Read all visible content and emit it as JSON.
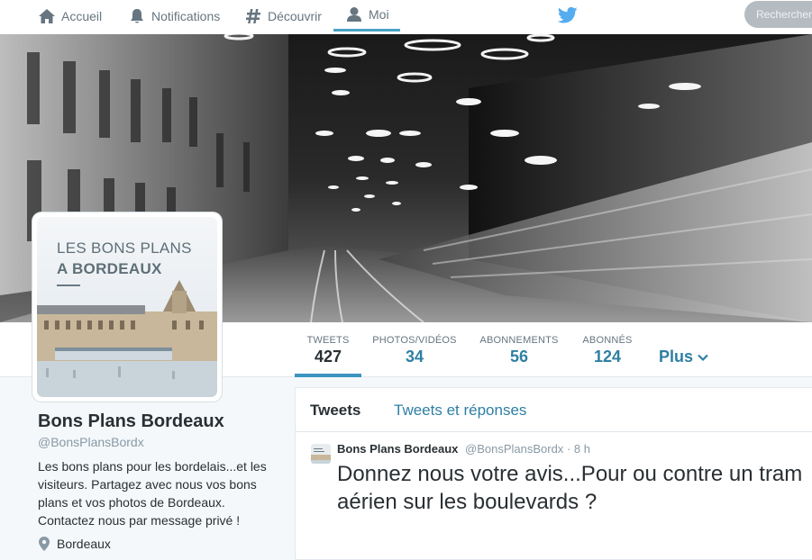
{
  "nav": {
    "home": "Accueil",
    "notifications": "Notifications",
    "discover": "Découvrir",
    "me": "Moi",
    "search_placeholder": "Rechercher"
  },
  "avatar": {
    "line1": "LES BONS PLANS",
    "line2": "A BORDEAUX"
  },
  "stats": {
    "tweets": {
      "label": "TWEETS",
      "value": "427"
    },
    "photos": {
      "label": "PHOTOS/VIDÉOS",
      "value": "34"
    },
    "following": {
      "label": "ABONNEMENTS",
      "value": "56"
    },
    "followers": {
      "label": "ABONNÉS",
      "value": "124"
    },
    "more": "Plus"
  },
  "profile": {
    "name": "Bons Plans Bordeaux",
    "handle": "@BonsPlansBordx",
    "bio": "Les bons plans pour les bordelais...et les visiteurs. Partagez avec nous vos bons plans et vos photos de Bordeaux. Contactez nous par message privé !",
    "location": "Bordeaux"
  },
  "timeline": {
    "tab_tweets": "Tweets",
    "tab_replies": "Tweets et réponses",
    "tweet": {
      "name": "Bons Plans Bordeaux",
      "handle": "@BonsPlansBordx",
      "dot": "·",
      "time": "8 h",
      "text": "Donnez nous votre avis...Pour ou contre un tram aérien sur les boulevards ?"
    }
  },
  "colors": {
    "accent": "#2f7fa3",
    "active_underline": "#3b94c0",
    "twitter_blue": "#55acee"
  },
  "icons": [
    "home-icon",
    "bell-icon",
    "hashtag-icon",
    "person-icon",
    "twitter-bird-icon",
    "chevron-down-icon",
    "location-pin-icon"
  ]
}
